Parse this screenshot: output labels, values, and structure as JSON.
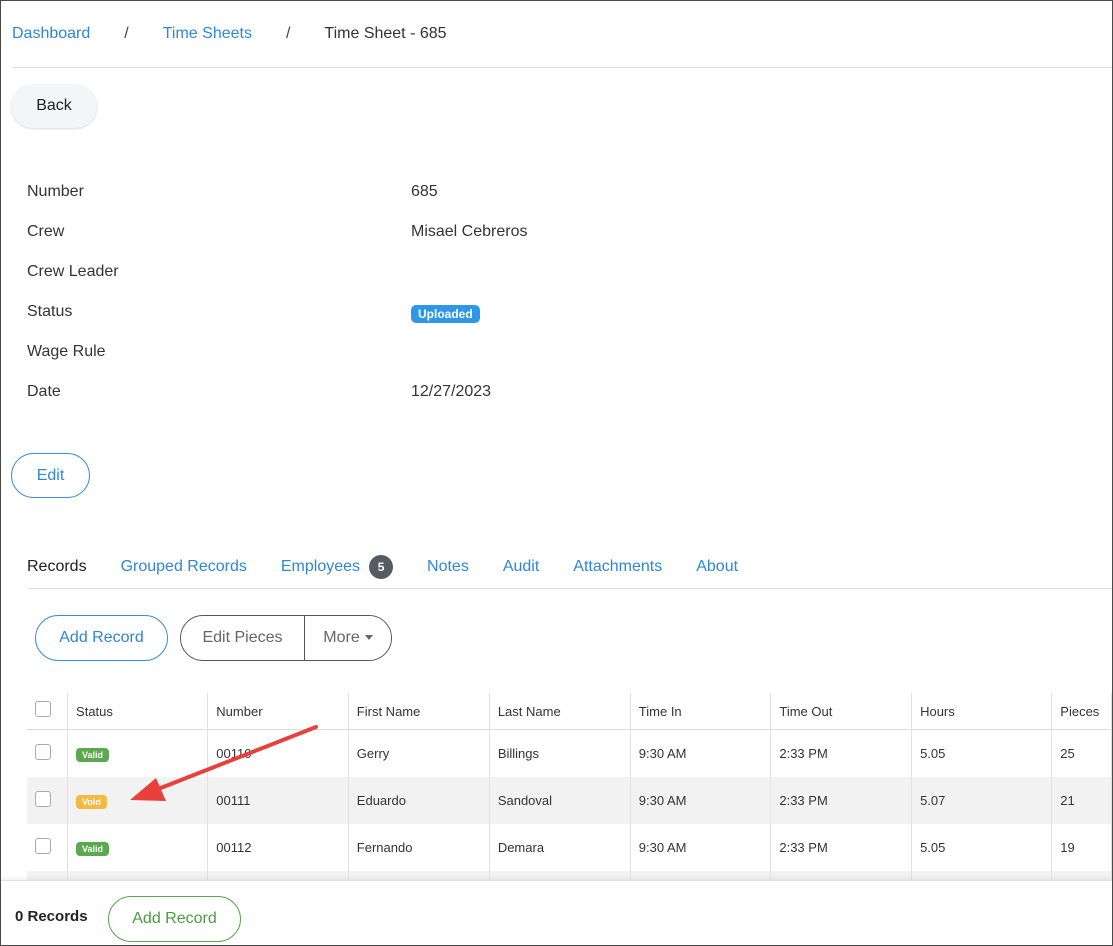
{
  "breadcrumb": {
    "dashboard": "Dashboard",
    "time_sheets": "Time Sheets",
    "current": "Time Sheet - 685",
    "separator": "/"
  },
  "back_label": "Back",
  "details": [
    {
      "label": "Number",
      "value": "685"
    },
    {
      "label": "Crew",
      "value": "Misael Cebreros"
    },
    {
      "label": "Crew Leader",
      "value": ""
    },
    {
      "label": "Status",
      "value": "Uploaded"
    },
    {
      "label": "Wage Rule",
      "value": ""
    },
    {
      "label": "Date",
      "value": "12/27/2023"
    }
  ],
  "edit_label": "Edit",
  "tabs": [
    {
      "label": "Records",
      "active": true
    },
    {
      "label": "Grouped Records"
    },
    {
      "label": "Employees",
      "count": "5"
    },
    {
      "label": "Notes"
    },
    {
      "label": "Audit"
    },
    {
      "label": "Attachments"
    },
    {
      "label": "About"
    }
  ],
  "toolbar": {
    "add_record": "Add Record",
    "edit_pieces": "Edit Pieces",
    "more": "More"
  },
  "table": {
    "columns": [
      "Status",
      "Number",
      "First Name",
      "Last Name",
      "Time In",
      "Time Out",
      "Hours",
      "Pieces"
    ],
    "rows": [
      {
        "status": "Valid",
        "number": "00110",
        "first": "Gerry",
        "last": "Billings",
        "time_in": "9:30 AM",
        "time_out": "2:33 PM",
        "hours": "5.05",
        "pieces": "25"
      },
      {
        "status": "Void",
        "number": "00111",
        "first": "Eduardo",
        "last": "Sandoval",
        "time_in": "9:30 AM",
        "time_out": "2:33 PM",
        "hours": "5.07",
        "pieces": "21"
      },
      {
        "status": "Valid",
        "number": "00112",
        "first": "Fernando",
        "last": "Demara",
        "time_in": "9:30 AM",
        "time_out": "2:33 PM",
        "hours": "5.05",
        "pieces": "19"
      }
    ]
  },
  "footer": {
    "records_count": "0 Records",
    "add_record": "Add Record"
  },
  "colors": {
    "link": "#2f87d6",
    "valid": "#5ca84f",
    "void": "#f5b942",
    "uploaded": "#2e97e8",
    "annotation_arrow": "#e8413c"
  }
}
